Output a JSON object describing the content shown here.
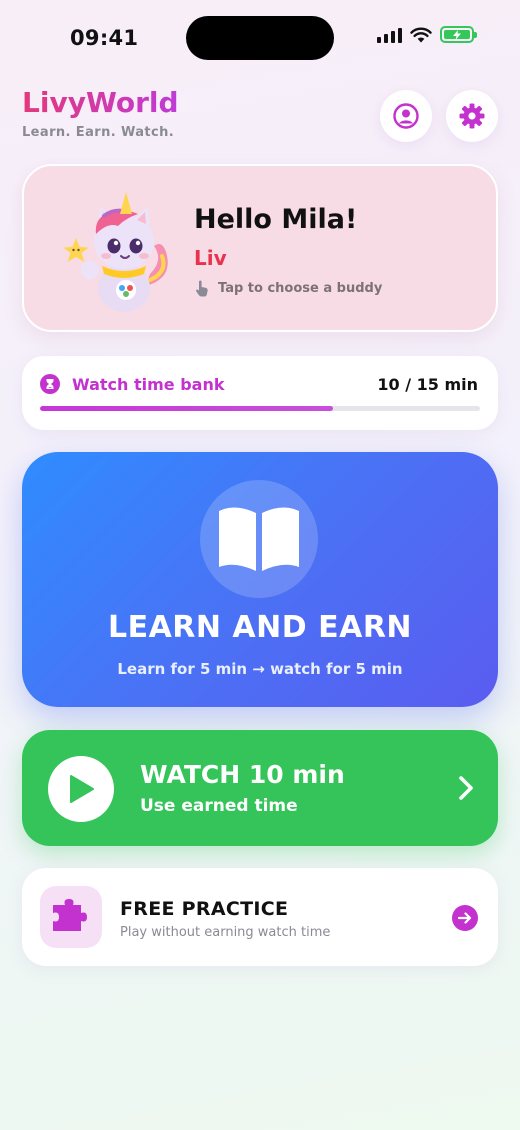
{
  "status_bar": {
    "time": "09:41"
  },
  "header": {
    "app_name": "LivyWorld",
    "tagline": "Learn. Earn. Watch."
  },
  "buddy": {
    "greeting": "Hello Mila!",
    "name": "Liv",
    "hint": "Tap to choose a buddy"
  },
  "time_bank": {
    "label": "Watch time bank",
    "value_text": "10 / 15 min",
    "used_min": 10,
    "total_min": 15
  },
  "learn_card": {
    "title": "LEARN AND EARN",
    "subtitle": "Learn for 5 min → watch for 5 min"
  },
  "watch_card": {
    "title": "WATCH 10 min",
    "subtitle": "Use earned time"
  },
  "practice_card": {
    "title": "FREE PRACTICE",
    "subtitle": "Play without earning watch time"
  },
  "colors": {
    "accent": "#c331cf",
    "brand_pink": "#e4387c",
    "learn_blue": "#4a72f5",
    "watch_green": "#34c45a",
    "buddy_red": "#e8334f"
  },
  "icons": [
    "profile-icon",
    "gear-icon",
    "hourglass-icon",
    "hand-tap-icon",
    "book-icon",
    "play-icon",
    "chevron-right-icon",
    "puzzle-icon",
    "arrow-right-icon"
  ]
}
